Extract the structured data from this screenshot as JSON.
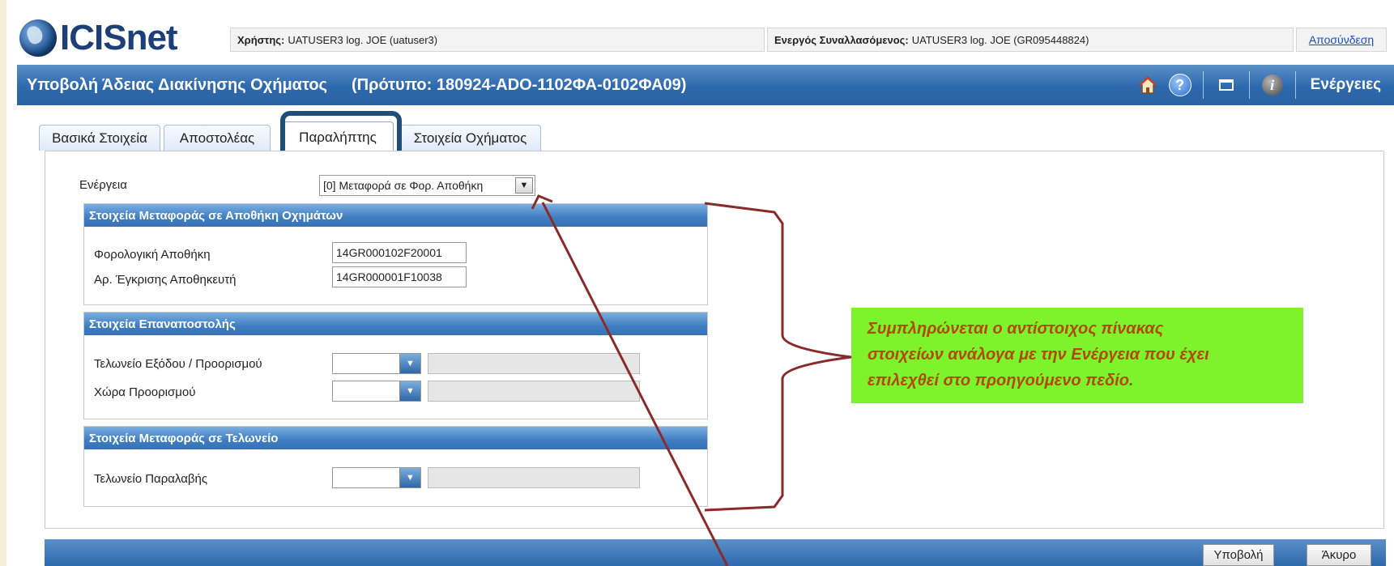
{
  "app": {
    "logo_text": "ICISnet"
  },
  "header": {
    "user_label": "Χρήστης:",
    "user_value": "UATUSER3 log. JOE (uatuser3)",
    "trader_label": "Ενεργός Συναλλασόμενος:",
    "trader_value": "UATUSER3 log. JOE (GR095448824)",
    "logout": "Αποσύνδεση"
  },
  "titlebar": {
    "title": "Υποβολή Άδειας Διακίνησης Οχήματος",
    "template": "(Πρότυπο: 180924-ADO-1102ΦΑ-0102ΦΑ09)",
    "actions": "Ενέργειες",
    "icons": [
      "home-icon",
      "help-icon",
      "window-icon",
      "info-icon"
    ]
  },
  "tabs": [
    {
      "label": "Βασικά Στοιχεία",
      "active": false
    },
    {
      "label": "Αποστολέας",
      "active": false
    },
    {
      "label": "Παραλήπτης",
      "active": true
    },
    {
      "label": "Στοιχεία Οχήματος",
      "active": false
    }
  ],
  "form": {
    "action_label": "Ενέργεια",
    "action_value": "[0] Μεταφορά σε Φορ. Αποθήκη",
    "sections": {
      "warehouse": {
        "title": "Στοιχεία Μεταφοράς σε Αποθήκη Οχημάτων",
        "tax_warehouse_label": "Φορολογική Αποθήκη",
        "tax_warehouse_value": "14GR000102F20001",
        "approval_label": "Αρ. Έγκρισης Αποθηκευτή",
        "approval_value": "14GR000001F10038"
      },
      "reexport": {
        "title": "Στοιχεία Επαναποστολής",
        "exit_office_label": "Τελωνείο Εξόδου / Προορισμού",
        "country_label": "Χώρα Προορισμού"
      },
      "customs": {
        "title": "Στοιχεία Μεταφοράς σε Τελωνείο",
        "receiving_office_label": "Τελωνείο Παραλαβής"
      }
    }
  },
  "callout": {
    "line1": "Συμπληρώνεται ο αντίστοιχος πίνακας",
    "line2": "στοιχείων ανάλογα με την Ενέργεια που έχει",
    "line3": "επιλεχθεί στο προηγούμενο πεδίο.",
    "color": "#7ef22b"
  },
  "footer": {
    "submit": "Υποβολή",
    "cancel": "Άκυρο"
  }
}
